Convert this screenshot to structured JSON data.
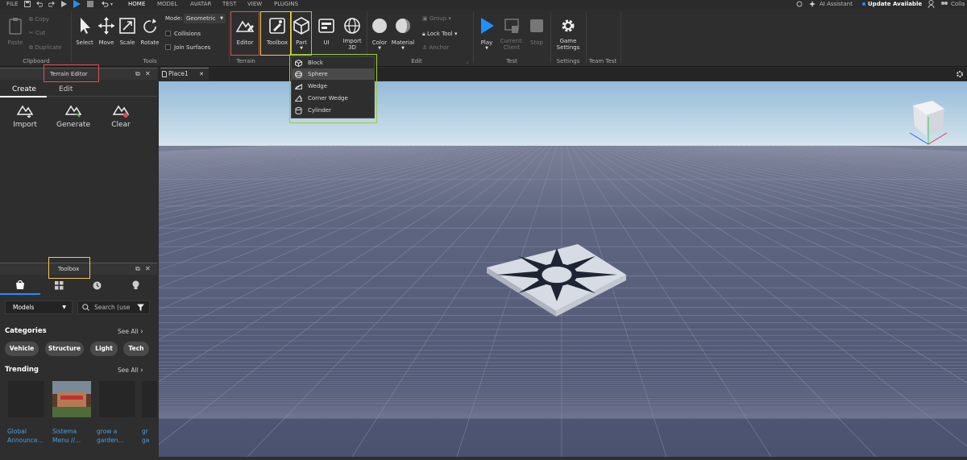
{
  "menubar": {
    "file": "FILE",
    "home": "HOME",
    "model": "MODEL",
    "avatar": "AVATAR",
    "test": "TEST",
    "view": "VIEW",
    "plugins": "PLUGINS",
    "ai": "AI Assistant",
    "update": "Update Available",
    "colla": "Colla"
  },
  "clipboard": {
    "paste": "Paste",
    "copy": "Copy",
    "cut": "Cut",
    "duplicate": "Duplicate",
    "label": "Clipboard"
  },
  "tools": {
    "select": "Select",
    "move": "Move",
    "scale": "Scale",
    "rotate": "Rotate",
    "mode_label": "Mode:",
    "mode_value": "Geometric",
    "collisions": "Collisions",
    "join": "Join Surfaces",
    "label": "Tools"
  },
  "terrain": {
    "editor": "Editor",
    "toolbox": "Toolbox",
    "label": "Terrain"
  },
  "insert": {
    "part": "Part",
    "ui": "UI",
    "import3d_1": "Import",
    "import3d_2": "3D"
  },
  "edit": {
    "color": "Color",
    "material": "Material",
    "group": "Group",
    "lock": "Lock Tool",
    "anchor": "Anchor",
    "label": "Edit"
  },
  "test": {
    "play": "Play",
    "current1": "Current:",
    "current2": "Client",
    "stop": "Stop",
    "label": "Test"
  },
  "settings": {
    "game1": "Game",
    "game2": "Settings",
    "label": "Settings"
  },
  "teamtest": {
    "label": "Team Test"
  },
  "part_menu": {
    "items": [
      "Block",
      "Sphere",
      "Wedge",
      "Corner Wedge",
      "Cylinder"
    ],
    "selected": "Sphere"
  },
  "terrain_editor": {
    "title": "Terrain Editor",
    "tab_create": "Create",
    "tab_edit": "Edit",
    "import": "Import",
    "generate": "Generate",
    "clear": "Clear"
  },
  "toolbox_panel": {
    "title": "Toolbox",
    "dropdown": "Models",
    "search_placeholder": "Search (use",
    "categories": "Categories",
    "see_all": "See All",
    "chips": [
      "Vehicle",
      "Structure",
      "Light",
      "Tech"
    ],
    "trending": "Trending",
    "tiles": [
      {
        "l1": "Global",
        "l2": "Announce..."
      },
      {
        "l1": "Sistema",
        "l2": "Menu //..."
      },
      {
        "l1": "grow a",
        "l2": "garden..."
      },
      {
        "l1": "gr",
        "l2": "ga"
      }
    ]
  },
  "viewport": {
    "tab": "Place1"
  },
  "colors": {
    "accent": "#1e90ff",
    "red_box": "#d9534f",
    "yellow_box": "#f2c94c",
    "green_box": "#9acd32",
    "link": "#4a9fe0",
    "sky_top": "#8fb8d8",
    "floor": "#4a5270"
  }
}
